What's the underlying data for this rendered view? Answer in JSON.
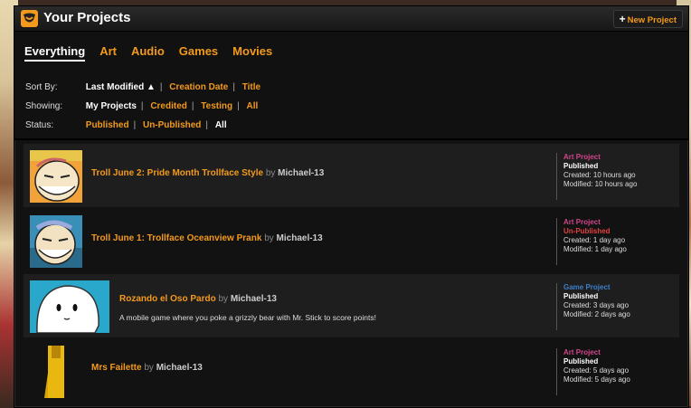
{
  "header": {
    "title": "Your Projects",
    "new_project": "New Project",
    "new_project_icon": "+"
  },
  "tabs": [
    {
      "label": "Everything",
      "active": true
    },
    {
      "label": "Art"
    },
    {
      "label": "Audio"
    },
    {
      "label": "Games"
    },
    {
      "label": "Movies"
    }
  ],
  "filters": {
    "sort_label": "Sort By:",
    "sort_options": [
      "Last Modified ▲",
      "Creation Date",
      "Title"
    ],
    "showing_label": "Showing:",
    "showing_options": [
      "My Projects",
      "Credited",
      "Testing",
      "All"
    ],
    "status_label": "Status:",
    "status_options": [
      "Published",
      "Un-Published",
      "All"
    ]
  },
  "projects": [
    {
      "title": "Troll June 2: Pride Month Trollface Style",
      "by": "by",
      "author": "Michael-13",
      "description": "",
      "type": "Art Project",
      "status": "Published",
      "created": "Created: 10 hours ago",
      "modified": "Modified: 10 hours ago"
    },
    {
      "title": "Troll June 1: Trollface Oceanview Prank",
      "by": "by",
      "author": "Michael-13",
      "description": "",
      "type": "Art Project",
      "status": "Un-Published",
      "created": "Created: 1 day ago",
      "modified": "Modified: 1 day ago"
    },
    {
      "title": "Rozando el Oso Pardo",
      "by": "by",
      "author": "Michael-13",
      "description": "A mobile game where you poke a grizzly bear with Mr. Stick to score points!",
      "type": "Game Project",
      "status": "Published",
      "created": "Created: 3 days ago",
      "modified": "Modified: 2 days ago"
    },
    {
      "title": "Mrs Failette",
      "by": "by",
      "author": "Michael-13",
      "description": "",
      "type": "Art Project",
      "status": "Published",
      "created": "Created: 5 days ago",
      "modified": "Modified: 5 days ago"
    }
  ],
  "colors": {
    "accent": "#f39a1c",
    "art_type": "#d0448a",
    "game_type": "#3f7fc9",
    "unpublished": "#e14040"
  }
}
